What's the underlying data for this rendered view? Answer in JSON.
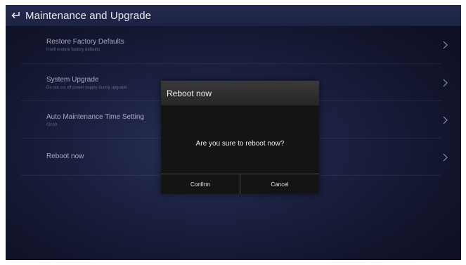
{
  "header": {
    "title": "Maintenance and Upgrade",
    "back_icon": "return-arrow-icon"
  },
  "menu": {
    "items": [
      {
        "title": "Restore Factory Defaults",
        "subtitle": "It will restore factory defaults"
      },
      {
        "title": "System Upgrade",
        "subtitle": "Do not cut off power supply during upgrade"
      },
      {
        "title": "Auto Maintenance Time Setting",
        "subtitle": "03:00"
      },
      {
        "title": "Reboot now",
        "subtitle": ""
      }
    ],
    "chevron_icon": "chevron-right-icon"
  },
  "dialog": {
    "title": "Reboot now",
    "message": "Are you sure to reboot now?",
    "confirm_label": "Confirm",
    "cancel_label": "Cancel"
  },
  "colors": {
    "header_bg": "#1f2546",
    "background": "#161a35",
    "dialog_bg": "#141414",
    "dialog_header_bg": "#2e2e2e",
    "text_primary": "#e6e8f2",
    "text_muted": "#a6aac2"
  }
}
